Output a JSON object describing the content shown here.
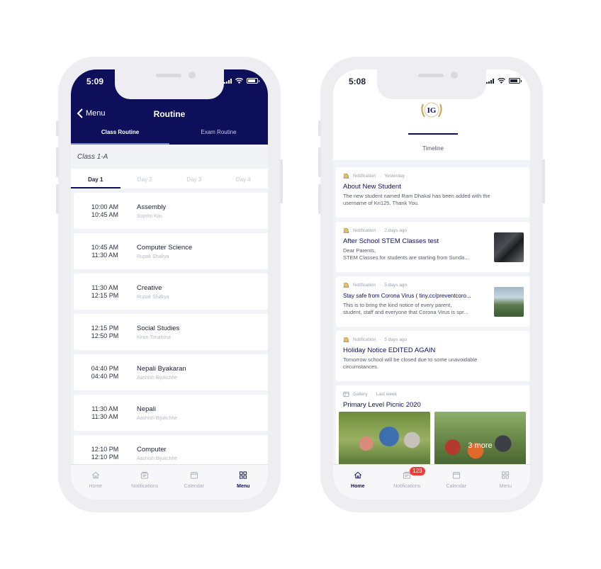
{
  "left": {
    "status_time": "5:09",
    "back_label": "Menu",
    "title": "Routine",
    "segments": [
      {
        "label": "Class Routine",
        "active": true
      },
      {
        "label": "Exam Routine",
        "active": false
      }
    ],
    "class_label": "Class 1-A",
    "days": [
      {
        "label": "Day 1",
        "active": true
      },
      {
        "label": "Day 2",
        "active": false
      },
      {
        "label": "Day 3",
        "active": false
      },
      {
        "label": "Day 4",
        "active": false
      }
    ],
    "routine": [
      {
        "start": "10:00 AM",
        "end": "10:45 AM",
        "subject": "Assembly",
        "teacher": "Suprim  Kiju"
      },
      {
        "start": "10:45 AM",
        "end": "11:30 AM",
        "subject": "Computer Science",
        "teacher": "Rupak Shakya"
      },
      {
        "start": "11:30 AM",
        "end": "12:15 PM",
        "subject": "Creative",
        "teacher": "Rupak Shakya"
      },
      {
        "start": "12:15 PM",
        "end": "12:50 PM",
        "subject": "Social Studies",
        "teacher": "Kiran Timalsina"
      },
      {
        "start": "04:40 PM",
        "end": "04:40 PM",
        "subject": "Nepali Byakaran",
        "teacher": "Aashish Bijukchhe"
      },
      {
        "start": "11:30 AM",
        "end": "11:30 AM",
        "subject": "Nepali",
        "teacher": "Aashish Bijukchhe"
      },
      {
        "start": "12:10 PM",
        "end": "12:10 PM",
        "subject": "Computer",
        "teacher": "Aashish Bijukchhe"
      }
    ],
    "tabs": [
      {
        "label": "Home",
        "icon": "home-icon",
        "active": false
      },
      {
        "label": "Notifications",
        "icon": "notifications-icon",
        "active": false
      },
      {
        "label": "Calendar",
        "icon": "calendar-icon",
        "active": false
      },
      {
        "label": "Menu",
        "icon": "menu-grid-icon",
        "active": true
      }
    ]
  },
  "right": {
    "status_time": "5:08",
    "logo_text": "IG",
    "timeline_label": "Timeline",
    "feed": [
      {
        "type": "Notification",
        "time": "Yesterday",
        "title": "About New Student",
        "body": "The new student named Ram Dhakal has been added with the\nusername of Kri125. Thank You.",
        "thumb": false
      },
      {
        "type": "Notification",
        "time": "2 days ago",
        "title": "After School STEM Classes test",
        "body": "Dear Parents,\nSTEM Classes for students are starting from Sunda...",
        "thumb": true
      },
      {
        "type": "Notification",
        "time": "5 days ago",
        "title": "Stay safe from Corona Virus ( tiny.cc/preventcoro...",
        "body": "This is to bring the kind notice of every parent,\nstudent, staff and everyone that Corona Virus is spr...",
        "thumb": true
      },
      {
        "type": "Notification",
        "time": "5 days ago",
        "title": "Holiday Notice EDITED AGAIN",
        "body": "Tomorrow school will be closed due to some unavoidable\ncircumstances.",
        "thumb": false
      }
    ],
    "gallery": {
      "type": "Gallery",
      "time": "Last week",
      "title": "Primary Level Picnic 2020",
      "more": "3 more"
    },
    "tabs": [
      {
        "label": "Home",
        "icon": "home-icon",
        "active": true
      },
      {
        "label": "Notifications",
        "icon": "notifications-icon",
        "active": false,
        "badge": "123"
      },
      {
        "label": "Calendar",
        "icon": "calendar-icon",
        "active": false
      },
      {
        "label": "Menu",
        "icon": "menu-grid-icon",
        "active": false
      }
    ]
  },
  "colors": {
    "navy": "#0d0f5a",
    "badge": "#f03b38",
    "background": "#f2f3f7"
  }
}
